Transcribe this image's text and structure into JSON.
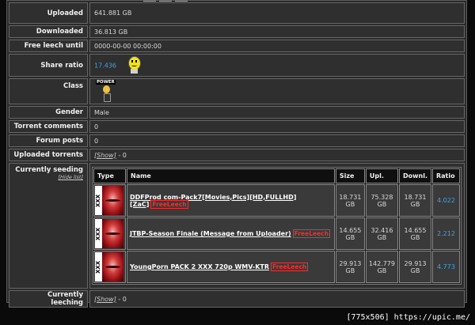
{
  "profile": {
    "uploaded": {
      "label": "Uploaded",
      "value": "641.881 GB"
    },
    "downloaded": {
      "label": "Downloaded",
      "value": "36.813 GB"
    },
    "freeleech": {
      "label": "Free leech until",
      "value": "0000-00-00 00:00:00"
    },
    "share_ratio": {
      "label": "Share ratio",
      "value": "17.436"
    },
    "class": {
      "label": "Class",
      "icon_text": "POWER"
    },
    "gender": {
      "label": "Gender",
      "value": "Male"
    },
    "torrent_comments": {
      "label": "Torrent comments",
      "value": "0"
    },
    "forum_posts": {
      "label": "Forum posts",
      "value": "0"
    },
    "uploaded_torrents": {
      "label": "Uploaded torrents",
      "show": "[Show]",
      "count": " - 0"
    },
    "currently_seeding": {
      "label": "Currently seeding",
      "hide": "[Hide list]"
    },
    "currently_leeching": {
      "label": "Currently leeching",
      "show": "[Show]",
      "count": " - 0"
    }
  },
  "seeding": {
    "headers": {
      "type": "Type",
      "name": "Name",
      "size": "Size",
      "upl": "Upl.",
      "downl": "Downl.",
      "ratio": "Ratio"
    },
    "rows": [
      {
        "type": "XXX",
        "name": "DDFProd com-Pack7[Movies,Pics][HD,FULLHD][ZaC]",
        "badge": "FreeLeech",
        "size": "18.731 GB",
        "upl": "75.328 GB",
        "downl": "18.731 GB",
        "ratio": "4.022"
      },
      {
        "type": "XXX",
        "name": "JTBP-Season Finale (Message from Uploader)",
        "badge": "FreeLeech",
        "size": "14.655 GB",
        "upl": "32.416 GB",
        "downl": "14.655 GB",
        "ratio": "2.212"
      },
      {
        "type": "XXX",
        "name": "YoungPorn PACK 2 XXX 720p WMV-KTR",
        "badge": "FreeLeech",
        "size": "29.913 GB",
        "upl": "142.779 GB",
        "downl": "29.913 GB",
        "ratio": "4.773"
      }
    ]
  },
  "watermark": "[775x506] https://upic.me/",
  "colors": {
    "link_blue": "#3ca3e6",
    "freeleech_red": "#ff2a2a",
    "panel": "#2f2f2f",
    "header": "#0f0f0f"
  }
}
